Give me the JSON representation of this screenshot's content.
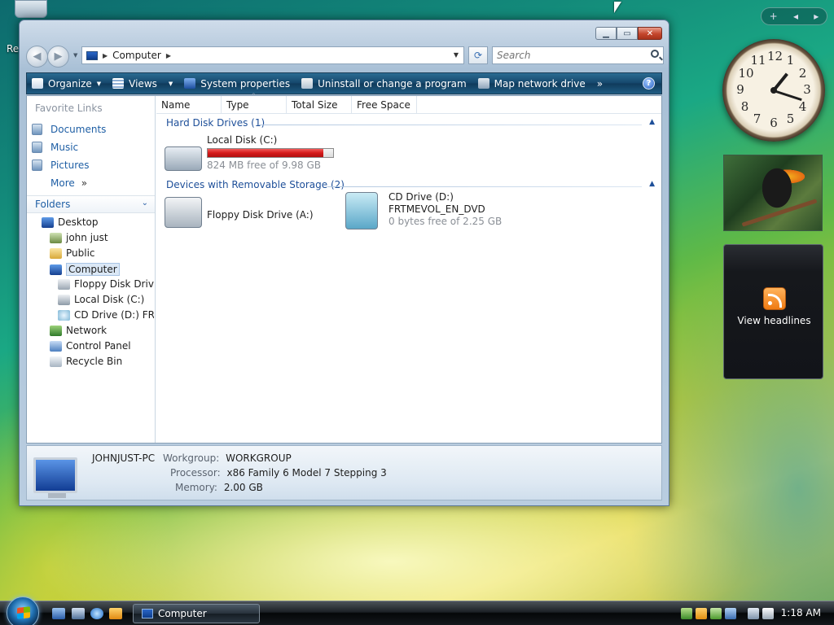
{
  "desktop": {
    "partial_icon_label": "Re"
  },
  "window": {
    "title": "Computer",
    "address": {
      "crumb": "Computer"
    },
    "search": {
      "placeholder": "Search"
    },
    "toolbar": {
      "organize": "Organize",
      "views": "Views",
      "system_properties": "System properties",
      "uninstall": "Uninstall or change a program",
      "map_drive": "Map network drive",
      "more": "»"
    },
    "nav_pane": {
      "favorites_heading": "Favorite Links",
      "favorites": [
        {
          "label": "Documents"
        },
        {
          "label": "Music"
        },
        {
          "label": "Pictures"
        },
        {
          "label": "More"
        }
      ],
      "more_glyph": "»",
      "folders_heading": "Folders",
      "tree": [
        {
          "label": "Desktop"
        },
        {
          "label": "john just"
        },
        {
          "label": "Public"
        },
        {
          "label": "Computer"
        },
        {
          "label": "Floppy Disk Drive"
        },
        {
          "label": "Local Disk (C:)"
        },
        {
          "label": "CD Drive (D:) FRTI"
        },
        {
          "label": "Network"
        },
        {
          "label": "Control Panel"
        },
        {
          "label": "Recycle Bin"
        }
      ]
    },
    "columns": [
      "Name",
      "Type",
      "Total Size",
      "Free Space"
    ],
    "groups": {
      "hdd_heading": "Hard Disk Drives (1)",
      "removable_heading": "Devices with Removable Storage (2)"
    },
    "drives": {
      "local": {
        "name": "Local Disk (C:)",
        "free_text": "824 MB free of 9.98 GB",
        "used_fraction": 0.92
      },
      "floppy": {
        "name": "Floppy Disk Drive (A:)"
      },
      "cd": {
        "name": "CD Drive (D:)",
        "label": "FRTMEVOL_EN_DVD",
        "free_text": "0 bytes free of 2.25 GB"
      }
    },
    "details": {
      "computer_name": "JOHNJUST-PC",
      "workgroup_key": "Workgroup:",
      "workgroup_val": "WORKGROUP",
      "processor_key": "Processor:",
      "processor_val": "x86 Family 6 Model 7 Stepping 3",
      "memory_key": "Memory:",
      "memory_val": "2.00 GB"
    }
  },
  "gadgets": {
    "sidebar_add": "+",
    "sidebar_prev": "◂",
    "sidebar_next": "▸",
    "clock_numbers": [
      "12",
      "1",
      "2",
      "3",
      "4",
      "5",
      "6",
      "7",
      "8",
      "9",
      "10",
      "11"
    ],
    "clock_time": "1:18",
    "feed_label": "View headlines"
  },
  "taskbar": {
    "task_label": "Computer",
    "time": "1:18 AM"
  },
  "colors": {
    "capacity_fill": "#d41a1a",
    "link_blue": "#1f5fa5",
    "toolbar_bg": "#14466b"
  }
}
